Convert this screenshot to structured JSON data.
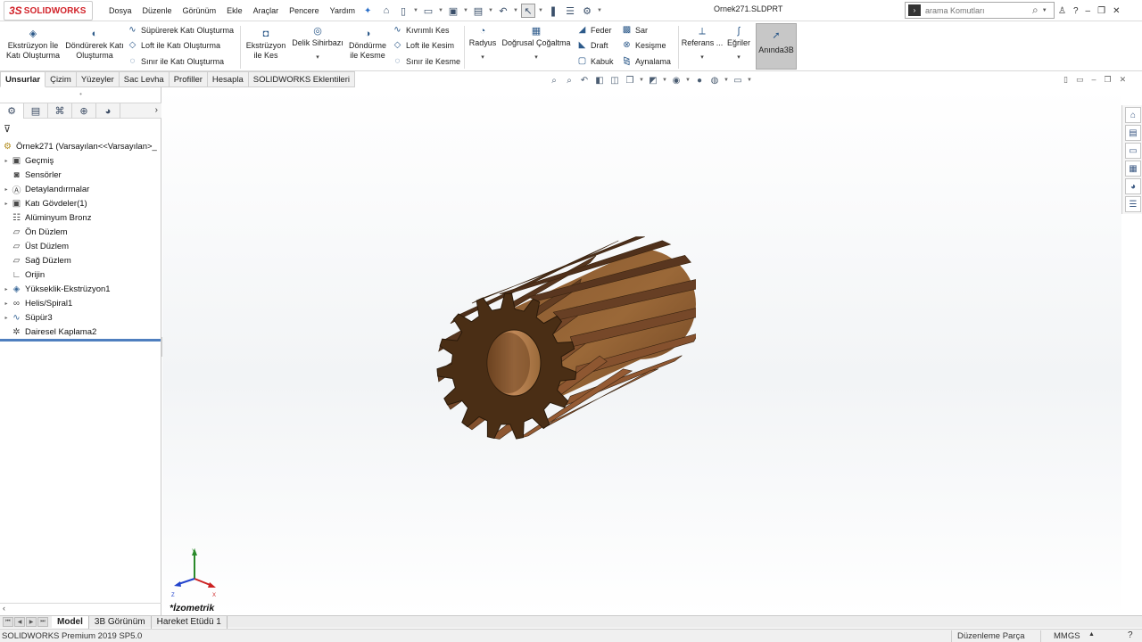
{
  "app": {
    "logo_ds": "3S",
    "logo_text": "SOLIDWORKS",
    "document_title": "Ornek271.SLDPRT"
  },
  "menu": {
    "items": [
      "Dosya",
      "Düzenle",
      "Görünüm",
      "Ekle",
      "Araçlar",
      "Pencere",
      "Yardım"
    ]
  },
  "search": {
    "placeholder": "arama Komutları"
  },
  "command_manager": {
    "extrude_boss": "Ekstrüzyon İle Katı Oluşturma",
    "revolve_boss": "Döndürerek Katı Oluşturma",
    "swept_boss": "Süpürerek Katı Oluşturma",
    "loft_boss": "Loft ile Katı Oluşturma",
    "boundary_boss": "Sınır ile Katı Oluşturma",
    "extrude_cut": "Ekstrüzyon ile Kes",
    "hole_wizard": "Delik Sihirbazı",
    "revolve_cut": "Döndürme ile Kesme",
    "swept_cut": "Kıvrımlı Kes",
    "loft_cut": "Loft ile Kesim",
    "boundary_cut": "Sınır ile Kesme",
    "fillet": "Radyus",
    "linear_pattern": "Doğrusal Çoğaltma",
    "rib": "Feder",
    "draft": "Draft",
    "shell": "Kabuk",
    "wrap": "Sar",
    "intersect": "Kesişme",
    "mirror": "Aynalama",
    "reference": "Referans ...",
    "curves": "Eğriler",
    "instant3d": "Anında3B"
  },
  "tabs": [
    "Unsurlar",
    "Çizim",
    "Yüzeyler",
    "Sac Levha",
    "Profiller",
    "Hesapla",
    "SOLIDWORKS Eklentileri"
  ],
  "feature_tree": {
    "root": "Örnek271  (Varsayılan<<Varsayılan>_",
    "nodes": [
      {
        "label": "Geçmiş",
        "expandable": true,
        "icon": "history-icon"
      },
      {
        "label": "Sensörler",
        "expandable": false,
        "icon": "sensor-icon"
      },
      {
        "label": "Detaylandırmalar",
        "expandable": true,
        "icon": "annotation-icon"
      },
      {
        "label": "Katı Gövdeler(1)",
        "expandable": true,
        "icon": "solid-bodies-icon"
      },
      {
        "label": "Alüminyum Bronz",
        "expandable": false,
        "icon": "material-icon"
      },
      {
        "label": "Ön Düzlem",
        "expandable": false,
        "icon": "plane-icon"
      },
      {
        "label": "Üst Düzlem",
        "expandable": false,
        "icon": "plane-icon"
      },
      {
        "label": "Sağ Düzlem",
        "expandable": false,
        "icon": "plane-icon"
      },
      {
        "label": "Orijin",
        "expandable": false,
        "icon": "origin-icon"
      },
      {
        "label": "Yükseklik-Ekstrüzyon1",
        "expandable": true,
        "icon": "extrude-icon"
      },
      {
        "label": "Helis/Spiral1",
        "expandable": true,
        "icon": "helix-icon"
      },
      {
        "label": "Süpür3",
        "expandable": true,
        "icon": "sweep-icon"
      },
      {
        "label": "Dairesel Kaplama2",
        "expandable": false,
        "icon": "circular-pattern-icon"
      }
    ]
  },
  "viewport": {
    "view_label": "*İzometrik",
    "gear_color": "#7a4a26",
    "gear_dark": "#4a2e15"
  },
  "bottom_tabs": [
    "Model",
    "3B Görünüm",
    "Hareket Etüdü 1"
  ],
  "status": {
    "product": "SOLIDWORKS Premium 2019 SP5.0",
    "mode": "Düzenleme Parça",
    "units": "MMGS",
    "help": "?"
  },
  "colors": {
    "brand_red": "#d2232a",
    "rollback_blue": "#4f7fbf"
  }
}
